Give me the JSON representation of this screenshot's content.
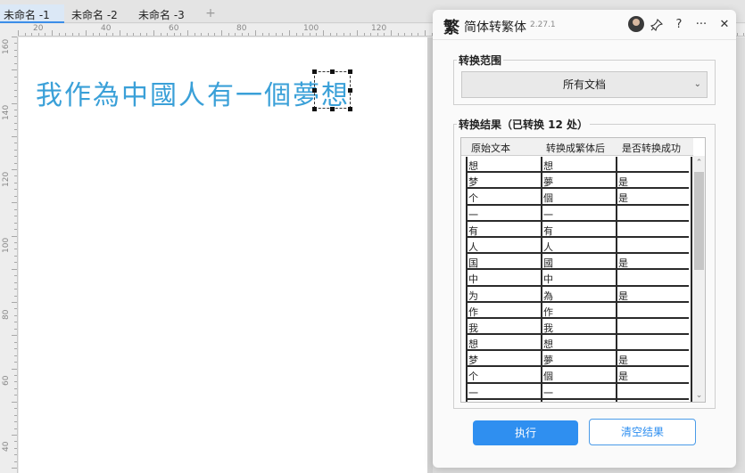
{
  "tabs": [
    {
      "label": "未命名 -1",
      "active": true
    },
    {
      "label": "未命名 -2",
      "active": false
    },
    {
      "label": "未命名 -3",
      "active": false
    }
  ],
  "tab_add_label": "+",
  "ruler": {
    "top_labels": [
      "20",
      "40",
      "60",
      "80",
      "100",
      "120"
    ],
    "left_labels": [
      "160",
      "140",
      "120",
      "100",
      "80",
      "60",
      "40"
    ]
  },
  "document": {
    "text": "我作為中國人有一個夢想"
  },
  "panel": {
    "icon_label": "繁",
    "title": "简体转繁体",
    "version": "2.27.1",
    "pin_icon": "⚲",
    "help_label": "?",
    "more_label": "···",
    "close_label": "✕",
    "scope_title": "转换范围",
    "scope_value": "所有文档",
    "result_title": "转换结果（已转换 12 处）",
    "columns": [
      "原始文本",
      "转换成繁体后",
      "是否转换成功"
    ],
    "rows": [
      [
        "想",
        "想",
        ""
      ],
      [
        "梦",
        "夢",
        "是"
      ],
      [
        "个",
        "個",
        "是"
      ],
      [
        "一",
        "一",
        ""
      ],
      [
        "有",
        "有",
        ""
      ],
      [
        "人",
        "人",
        ""
      ],
      [
        "国",
        "國",
        "是"
      ],
      [
        "中",
        "中",
        ""
      ],
      [
        "为",
        "為",
        "是"
      ],
      [
        "作",
        "作",
        ""
      ],
      [
        "我",
        "我",
        ""
      ],
      [
        "想",
        "想",
        ""
      ],
      [
        "梦",
        "夢",
        "是"
      ],
      [
        "个",
        "個",
        "是"
      ],
      [
        "一",
        "一",
        ""
      ]
    ],
    "execute_label": "执行",
    "clear_label": "清空结果"
  },
  "colors": {
    "accent": "#2f8ff0",
    "doc_text": "#3aa0d8"
  }
}
